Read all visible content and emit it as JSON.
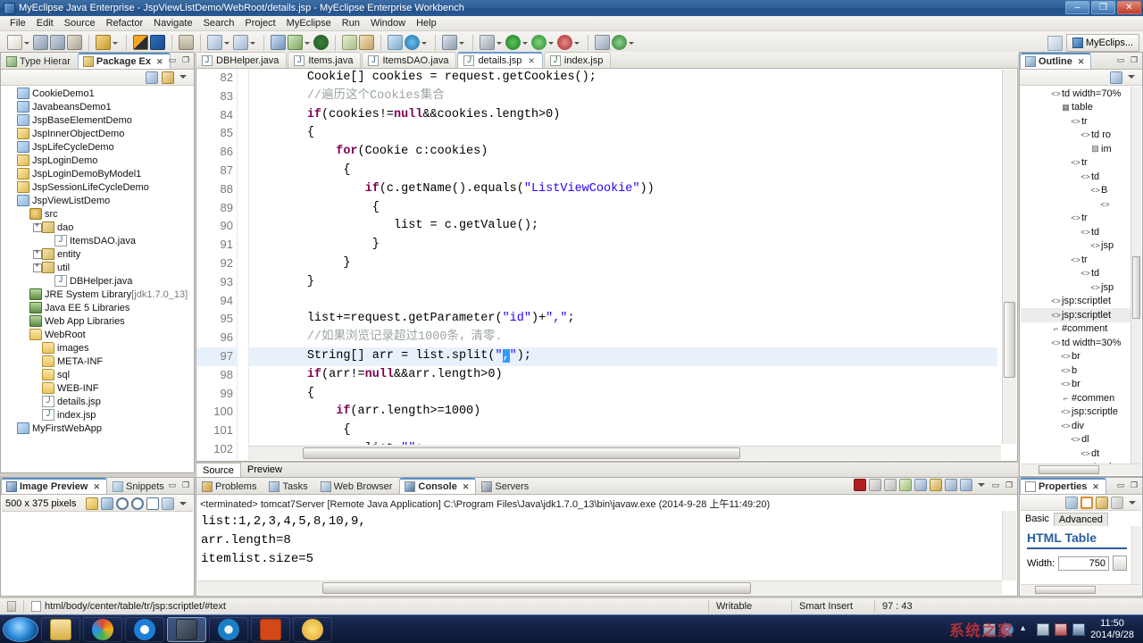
{
  "window": {
    "title": "MyEclipse Java Enterprise - JspViewListDemo/WebRoot/details.jsp - MyEclipse Enterprise Workbench",
    "icon": "myeclipse-icon",
    "minimize": "–",
    "maximize": "❐",
    "close": "✕"
  },
  "menu": {
    "items": [
      "File",
      "Edit",
      "Source",
      "Refactor",
      "Navigate",
      "Search",
      "Project",
      "MyEclipse",
      "Run",
      "Window",
      "Help"
    ]
  },
  "perspective": {
    "open_label": "open-perspective-icon",
    "current": "MyEclips..."
  },
  "package_explorer": {
    "tabs": [
      {
        "label": "Type Hierar",
        "icon": "type-hierarchy-icon",
        "active": false
      },
      {
        "label": "Package Ex",
        "icon": "package-explorer-icon",
        "active": true
      }
    ],
    "tree": [
      {
        "label": "CookieDemo1",
        "indent": 0,
        "icon": "java-project-icon",
        "twisty": "none"
      },
      {
        "label": "JavabeansDemo1",
        "indent": 0,
        "icon": "java-project-icon",
        "twisty": "none"
      },
      {
        "label": "JspBaseElementDemo",
        "indent": 0,
        "icon": "java-project-icon",
        "twisty": "none"
      },
      {
        "label": "JspInnerObjectDemo",
        "indent": 0,
        "icon": "web-project-icon",
        "twisty": "none"
      },
      {
        "label": "JspLifeCycleDemo",
        "indent": 0,
        "icon": "java-project-icon",
        "twisty": "none"
      },
      {
        "label": "JspLoginDemo",
        "indent": 0,
        "icon": "web-project-icon",
        "twisty": "none"
      },
      {
        "label": "JspLoginDemoByModel1",
        "indent": 0,
        "icon": "web-project-icon",
        "twisty": "none"
      },
      {
        "label": "JspSessionLifeCycleDemo",
        "indent": 0,
        "icon": "web-project-icon",
        "twisty": "none"
      },
      {
        "label": "JspViewListDemo",
        "indent": 0,
        "icon": "java-project-icon",
        "twisty": "none"
      },
      {
        "label": "src",
        "indent": 1,
        "icon": "source-folder-icon",
        "twisty": "none"
      },
      {
        "label": "dao",
        "indent": 2,
        "icon": "package-icon",
        "twisty": "plus"
      },
      {
        "label": "ItemsDAO.java",
        "indent": 3,
        "icon": "java-file-icon",
        "twisty": "none"
      },
      {
        "label": "entity",
        "indent": 2,
        "icon": "package-icon",
        "twisty": "plus"
      },
      {
        "label": "util",
        "indent": 2,
        "icon": "package-icon",
        "twisty": "plus"
      },
      {
        "label": "DBHelper.java",
        "indent": 3,
        "icon": "java-file-icon",
        "twisty": "none"
      },
      {
        "label": "JRE System Library",
        "suffix": "[jdk1.7.0_13]",
        "indent": 1,
        "icon": "library-icon",
        "twisty": "none"
      },
      {
        "label": "Java EE 5 Libraries",
        "indent": 1,
        "icon": "library-icon",
        "twisty": "none"
      },
      {
        "label": "Web App Libraries",
        "indent": 1,
        "icon": "library-icon",
        "twisty": "none"
      },
      {
        "label": "WebRoot",
        "indent": 1,
        "icon": "folder-icon",
        "twisty": "none"
      },
      {
        "label": "images",
        "indent": 2,
        "icon": "folder-icon",
        "twisty": "none"
      },
      {
        "label": "META-INF",
        "indent": 2,
        "icon": "folder-icon",
        "twisty": "none"
      },
      {
        "label": "sql",
        "indent": 2,
        "icon": "folder-icon",
        "twisty": "none"
      },
      {
        "label": "WEB-INF",
        "indent": 2,
        "icon": "folder-icon",
        "twisty": "none"
      },
      {
        "label": "details.jsp",
        "indent": 2,
        "icon": "jsp-file-icon",
        "twisty": "none"
      },
      {
        "label": "index.jsp",
        "indent": 2,
        "icon": "jsp-file-icon",
        "twisty": "none"
      },
      {
        "label": "MyFirstWebApp",
        "indent": 0,
        "icon": "java-project-icon",
        "twisty": "none"
      }
    ]
  },
  "image_preview": {
    "tabs": [
      {
        "label": "Image Preview",
        "icon": "image-preview-icon",
        "active": true
      },
      {
        "label": "Snippets",
        "icon": "snippets-icon",
        "active": false
      }
    ],
    "size_text": "500 x 375 pixels",
    "tools": [
      "refresh-icon",
      "fit-image-icon",
      "zoom-out-icon",
      "zoom-in-icon",
      "actual-size-icon",
      "fit-window-icon",
      "menu-icon"
    ]
  },
  "editor": {
    "tabs": [
      {
        "label": "DBHelper.java",
        "icon": "java-file-icon",
        "active": false,
        "closable": false
      },
      {
        "label": "Items.java",
        "icon": "java-file-icon",
        "active": false,
        "closable": false
      },
      {
        "label": "ItemsDAO.java",
        "icon": "java-file-icon",
        "active": false,
        "closable": false
      },
      {
        "label": "details.jsp",
        "icon": "jsp-file-icon",
        "active": true,
        "closable": true
      },
      {
        "label": "index.jsp",
        "icon": "jsp-file-icon",
        "active": false,
        "closable": false
      }
    ],
    "close_mark": "✕",
    "bottom_tabs": [
      {
        "label": "Source",
        "active": true
      },
      {
        "label": "Preview",
        "active": false
      }
    ],
    "lines": [
      {
        "num": "82",
        "indent": 8,
        "highlight": false,
        "tokens": [
          {
            "t": "Cookie[] cookies = request.getCookies();",
            "c": "plain"
          }
        ]
      },
      {
        "num": "83",
        "indent": 8,
        "highlight": false,
        "tokens": [
          {
            "t": "//遍历这个Cookies集合",
            "c": "cmt"
          }
        ]
      },
      {
        "num": "84",
        "indent": 8,
        "highlight": false,
        "tokens": [
          {
            "t": "if",
            "c": "kw"
          },
          {
            "t": "(cookies!=",
            "c": "plain"
          },
          {
            "t": "null",
            "c": "kw"
          },
          {
            "t": "&&cookies.length>0)",
            "c": "plain"
          }
        ]
      },
      {
        "num": "85",
        "indent": 8,
        "highlight": false,
        "tokens": [
          {
            "t": "{",
            "c": "plain"
          }
        ]
      },
      {
        "num": "86",
        "indent": 12,
        "highlight": false,
        "tokens": [
          {
            "t": "for",
            "c": "kw"
          },
          {
            "t": "(Cookie c:cookies)",
            "c": "plain"
          }
        ]
      },
      {
        "num": "87",
        "indent": 13,
        "highlight": false,
        "tokens": [
          {
            "t": "{",
            "c": "plain"
          }
        ]
      },
      {
        "num": "88",
        "indent": 16,
        "highlight": false,
        "tokens": [
          {
            "t": "if",
            "c": "kw"
          },
          {
            "t": "(c.getName().equals(",
            "c": "plain"
          },
          {
            "t": "\"ListViewCookie\"",
            "c": "str"
          },
          {
            "t": "))",
            "c": "plain"
          }
        ]
      },
      {
        "num": "89",
        "indent": 17,
        "highlight": false,
        "tokens": [
          {
            "t": "{",
            "c": "plain"
          }
        ]
      },
      {
        "num": "90",
        "indent": 20,
        "highlight": false,
        "tokens": [
          {
            "t": "list = c.getValue();",
            "c": "plain"
          }
        ]
      },
      {
        "num": "91",
        "indent": 17,
        "highlight": false,
        "tokens": [
          {
            "t": "}",
            "c": "plain"
          }
        ]
      },
      {
        "num": "92",
        "indent": 13,
        "highlight": false,
        "tokens": [
          {
            "t": "}",
            "c": "plain"
          }
        ]
      },
      {
        "num": "93",
        "indent": 8,
        "highlight": false,
        "tokens": [
          {
            "t": "}",
            "c": "plain"
          }
        ]
      },
      {
        "num": "94",
        "indent": 8,
        "highlight": false,
        "tokens": []
      },
      {
        "num": "95",
        "indent": 8,
        "highlight": false,
        "tokens": [
          {
            "t": "list+=request.getParameter(",
            "c": "plain"
          },
          {
            "t": "\"id\"",
            "c": "str"
          },
          {
            "t": ")+",
            "c": "plain"
          },
          {
            "t": "\",\"",
            "c": "str"
          },
          {
            "t": ";",
            "c": "plain"
          }
        ]
      },
      {
        "num": "96",
        "indent": 8,
        "highlight": false,
        "tokens": [
          {
            "t": "//如果浏览记录超过1000条，清零.",
            "c": "cmt"
          }
        ]
      },
      {
        "num": "97",
        "indent": 8,
        "highlight": true,
        "tokens": [
          {
            "t": "String[] arr = list.split(",
            "c": "plain"
          },
          {
            "t": "\"",
            "c": "str"
          },
          {
            "t": ",",
            "c": "sel"
          },
          {
            "t": "\"",
            "c": "str"
          },
          {
            "t": ");",
            "c": "plain"
          }
        ]
      },
      {
        "num": "98",
        "indent": 8,
        "highlight": false,
        "tokens": [
          {
            "t": "if",
            "c": "kw"
          },
          {
            "t": "(arr!=",
            "c": "plain"
          },
          {
            "t": "null",
            "c": "kw"
          },
          {
            "t": "&&arr.length>0)",
            "c": "plain"
          }
        ]
      },
      {
        "num": "99",
        "indent": 8,
        "highlight": false,
        "tokens": [
          {
            "t": "{",
            "c": "plain"
          }
        ]
      },
      {
        "num": "100",
        "indent": 12,
        "highlight": false,
        "tokens": [
          {
            "t": "if",
            "c": "kw"
          },
          {
            "t": "(arr.length>=1000)",
            "c": "plain"
          }
        ]
      },
      {
        "num": "101",
        "indent": 13,
        "highlight": false,
        "tokens": [
          {
            "t": "{",
            "c": "plain"
          }
        ]
      },
      {
        "num": "102",
        "indent": 16,
        "highlight": false,
        "tokens": [
          {
            "t": "list=",
            "c": "plain"
          },
          {
            "t": "\"\"",
            "c": "str"
          },
          {
            "t": ";",
            "c": "plain"
          }
        ]
      }
    ]
  },
  "outline": {
    "tabs": [
      {
        "label": "Outline",
        "icon": "outline-icon",
        "active": true
      }
    ],
    "nodes": [
      {
        "label": "td width=70%",
        "indent": 3,
        "glyph": "<>",
        "selected": false
      },
      {
        "label": "table",
        "indent": 4,
        "glyph": "▦",
        "selected": false
      },
      {
        "label": "tr",
        "indent": 5,
        "glyph": "<>",
        "selected": false
      },
      {
        "label": "td ro",
        "indent": 6,
        "glyph": "<>",
        "selected": false
      },
      {
        "label": "im",
        "indent": 7,
        "glyph": "▨",
        "selected": false
      },
      {
        "label": "tr",
        "indent": 5,
        "glyph": "<>",
        "selected": false
      },
      {
        "label": "td",
        "indent": 6,
        "glyph": "<>",
        "selected": false
      },
      {
        "label": "B",
        "indent": 7,
        "glyph": "<>",
        "selected": false
      },
      {
        "label": "",
        "indent": 8,
        "glyph": "<>",
        "selected": false
      },
      {
        "label": "tr",
        "indent": 5,
        "glyph": "<>",
        "selected": false
      },
      {
        "label": "td",
        "indent": 6,
        "glyph": "<>",
        "selected": false
      },
      {
        "label": "jsp",
        "indent": 7,
        "glyph": "<>",
        "selected": false
      },
      {
        "label": "tr",
        "indent": 5,
        "glyph": "<>",
        "selected": false
      },
      {
        "label": "td",
        "indent": 6,
        "glyph": "<>",
        "selected": false
      },
      {
        "label": "jsp",
        "indent": 7,
        "glyph": "<>",
        "selected": false
      },
      {
        "label": "jsp:scriptlet",
        "indent": 3,
        "glyph": "<>",
        "selected": false
      },
      {
        "label": "jsp:scriptlet",
        "indent": 3,
        "glyph": "<>",
        "selected": true
      },
      {
        "label": "#comment",
        "indent": 3,
        "glyph": "⌐",
        "selected": false
      },
      {
        "label": "td width=30%",
        "indent": 3,
        "glyph": "<>",
        "selected": false
      },
      {
        "label": "br",
        "indent": 4,
        "glyph": "<>",
        "selected": false
      },
      {
        "label": "b",
        "indent": 4,
        "glyph": "<>",
        "selected": false
      },
      {
        "label": "br",
        "indent": 4,
        "glyph": "<>",
        "selected": false
      },
      {
        "label": "#commen",
        "indent": 4,
        "glyph": "⌐",
        "selected": false
      },
      {
        "label": "jsp:scriptle",
        "indent": 4,
        "glyph": "<>",
        "selected": false
      },
      {
        "label": "div",
        "indent": 4,
        "glyph": "<>",
        "selected": false
      },
      {
        "label": "dl",
        "indent": 5,
        "glyph": "<>",
        "selected": false
      },
      {
        "label": "dt",
        "indent": 6,
        "glyph": "<>",
        "selected": false
      },
      {
        "label": "a h",
        "indent": 7,
        "glyph": "⚓",
        "selected": false
      }
    ]
  },
  "console": {
    "tabs": [
      {
        "label": "Problems",
        "icon": "problems-icon",
        "active": false
      },
      {
        "label": "Tasks",
        "icon": "tasks-icon",
        "active": false
      },
      {
        "label": "Web Browser",
        "icon": "web-browser-icon",
        "active": false
      },
      {
        "label": "Console",
        "icon": "console-icon",
        "active": true
      },
      {
        "label": "Servers",
        "icon": "servers-icon",
        "active": false
      }
    ],
    "process_line": "<terminated> tomcat7Server [Remote Java Application] C:\\Program Files\\Java\\jdk1.7.0_13\\bin\\javaw.exe (2014-9-28 上午11:49:20)",
    "output": [
      "list:1,2,3,4,5,8,10,9,",
      "arr.length=8",
      "itemlist.size=5"
    ],
    "tools": [
      "terminate-icon",
      "remove-launch-icon",
      "remove-all-icon",
      "clear-console-icon",
      "scroll-lock-icon",
      "pin-console-icon",
      "display-selected-console-icon",
      "open-console-icon",
      "view-menu-icon",
      "minimize-icon",
      "maximize-icon"
    ]
  },
  "properties": {
    "tabs": [
      {
        "label": "Properties",
        "icon": "properties-icon",
        "active": true
      }
    ],
    "mode_tabs": [
      {
        "label": "Basic",
        "active": false
      },
      {
        "label": "Advanced",
        "active": true
      }
    ],
    "title": "HTML Table",
    "fields": [
      {
        "label": "Width:",
        "value": "750"
      }
    ]
  },
  "status_bar": {
    "left_icon": "smart-insert-icon",
    "path_icon": "document-icon",
    "path": "html/body/center/table/tr/jsp:scriptlet/#text",
    "writable": "Writable",
    "insert_mode": "Smart Insert",
    "cursor_position": "97 : 43"
  },
  "taskbar": {
    "start": "start-orb",
    "items": [
      {
        "name": "windows-explorer-icon",
        "color": "#e8c778",
        "active": false
      },
      {
        "name": "browser-icon",
        "color": "#e06a3a",
        "active": false
      },
      {
        "name": "media-player-icon",
        "color": "#1c7fd6",
        "active": false
      },
      {
        "name": "myeclipse-icon",
        "color": "#3e4a5c",
        "active": true
      },
      {
        "name": "sogou-browser-icon",
        "color": "#1b7fc4",
        "active": false
      },
      {
        "name": "powerpoint-icon",
        "color": "#d34817",
        "active": false
      },
      {
        "name": "chat-icon",
        "color": "#f2c14a",
        "active": false
      }
    ],
    "tray": [
      "screen-icon",
      "ie-icon",
      "hidden-icons-icon",
      "show-desktop-icon",
      "volume-icon",
      "network-icon",
      "action-center-icon"
    ],
    "time": "11:50",
    "date": "2014/9/28",
    "watermark": "系统之家"
  },
  "colors": {
    "title_blue": "#2f5f96",
    "accent": "#2a5d9e",
    "keyword": "#7f0055",
    "string": "#2a00ff",
    "comment": "#9ba7a0",
    "selection": "#3399ff",
    "line_highlight": "#e8f1fb"
  }
}
